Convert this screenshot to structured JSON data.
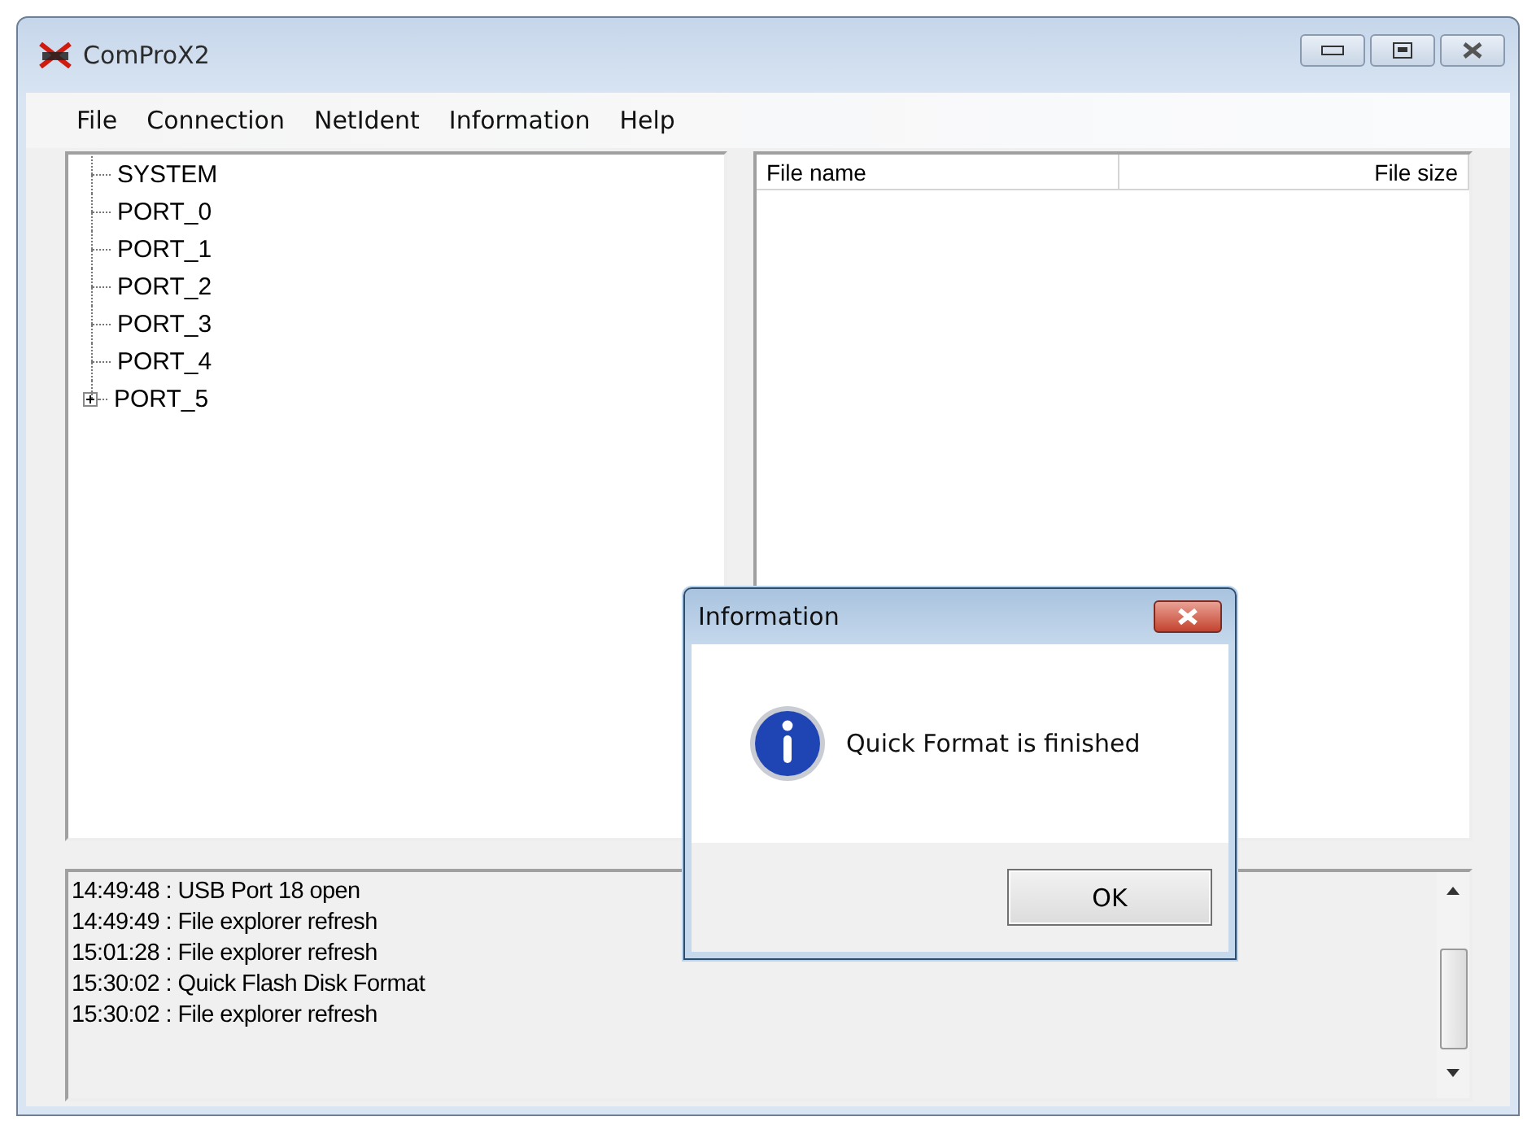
{
  "window": {
    "title": "ComProX2"
  },
  "menu": [
    "File",
    "Connection",
    "NetIdent",
    "Information",
    "Help"
  ],
  "tree": [
    {
      "label": "SYSTEM",
      "kind": "leaf"
    },
    {
      "label": "PORT_0",
      "kind": "leaf"
    },
    {
      "label": "PORT_1",
      "kind": "leaf"
    },
    {
      "label": "PORT_2",
      "kind": "leaf"
    },
    {
      "label": "PORT_3",
      "kind": "leaf"
    },
    {
      "label": "PORT_4",
      "kind": "leaf"
    },
    {
      "label": "PORT_5",
      "kind": "node",
      "expanded": false
    }
  ],
  "file_list": {
    "columns": [
      "File name",
      "File size"
    ]
  },
  "log": [
    "14:49:48 : USB Port 18 open",
    "14:49:49 : File explorer refresh",
    "15:01:28 : File explorer refresh",
    "15:30:02 : Quick Flash Disk Format",
    "15:30:02 : File explorer refresh"
  ],
  "dialog": {
    "title": "Information",
    "message": "Quick Format is finished",
    "buttons": [
      "OK"
    ]
  }
}
